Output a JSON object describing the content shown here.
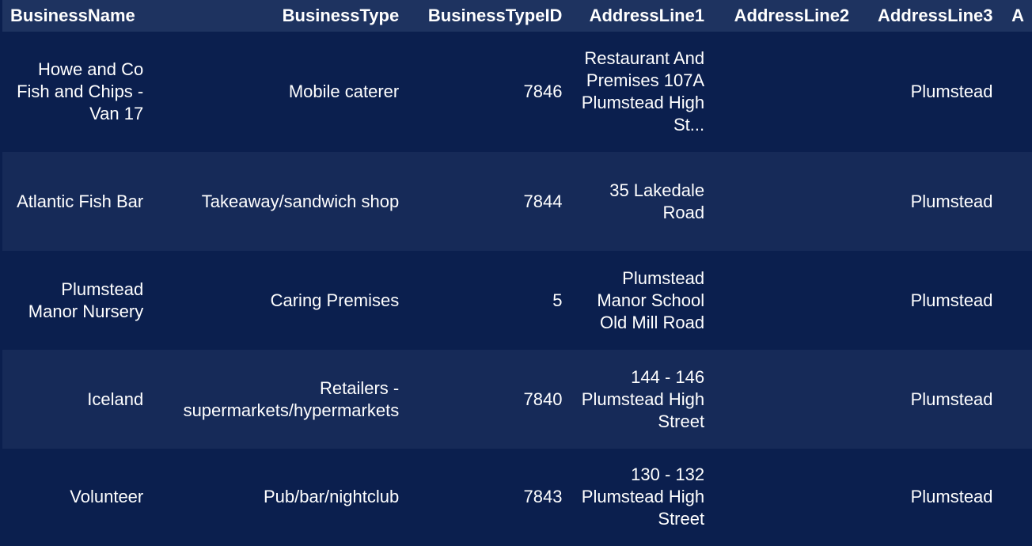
{
  "table": {
    "columns": [
      "BusinessName",
      "BusinessType",
      "BusinessTypeID",
      "AddressLine1",
      "AddressLine2",
      "AddressLine3",
      "A"
    ],
    "rows": [
      {
        "business_name": "Howe and Co Fish and Chips - Van 17",
        "business_type": "Mobile caterer",
        "business_type_id": "7846",
        "address_line1": "Restaurant And Premises 107A Plumstead High St...",
        "address_line2": "",
        "address_line3": "Plumstead"
      },
      {
        "business_name": "Atlantic Fish Bar",
        "business_type": "Takeaway/sandwich shop",
        "business_type_id": "7844",
        "address_line1": "35 Lakedale Road",
        "address_line2": "",
        "address_line3": "Plumstead"
      },
      {
        "business_name": "Plumstead Manor Nursery",
        "business_type": "Caring Premises",
        "business_type_id": "5",
        "address_line1": "Plumstead Manor School Old Mill Road",
        "address_line2": "",
        "address_line3": "Plumstead"
      },
      {
        "business_name": "Iceland",
        "business_type": "Retailers - supermarkets/hypermarkets",
        "business_type_id": "7840",
        "address_line1": "144 - 146 Plumstead High Street",
        "address_line2": "",
        "address_line3": "Plumstead"
      },
      {
        "business_name": "Volunteer",
        "business_type": "Pub/bar/nightclub",
        "business_type_id": "7843",
        "address_line1": "130 - 132 Plumstead High Street",
        "address_line2": "",
        "address_line3": "Plumstead"
      }
    ]
  },
  "colors": {
    "background": "#0b1f4e",
    "header_background": "#1e3360",
    "alt_row": "#162a58",
    "text": "#ffffff"
  }
}
